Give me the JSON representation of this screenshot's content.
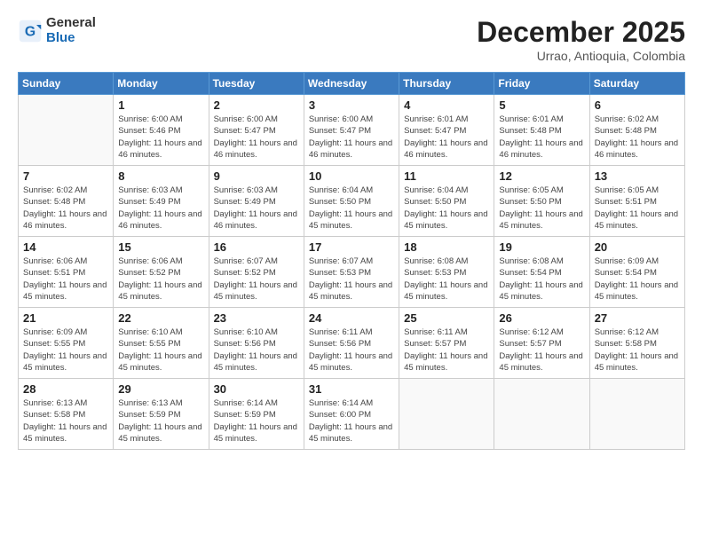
{
  "logo": {
    "general": "General",
    "blue": "Blue"
  },
  "header": {
    "month": "December 2025",
    "location": "Urrao, Antioquia, Colombia"
  },
  "weekdays": [
    "Sunday",
    "Monday",
    "Tuesday",
    "Wednesday",
    "Thursday",
    "Friday",
    "Saturday"
  ],
  "weeks": [
    [
      {
        "day": null
      },
      {
        "day": 1,
        "sunrise": "6:00 AM",
        "sunset": "5:46 PM",
        "daylight": "11 hours and 46 minutes."
      },
      {
        "day": 2,
        "sunrise": "6:00 AM",
        "sunset": "5:47 PM",
        "daylight": "11 hours and 46 minutes."
      },
      {
        "day": 3,
        "sunrise": "6:00 AM",
        "sunset": "5:47 PM",
        "daylight": "11 hours and 46 minutes."
      },
      {
        "day": 4,
        "sunrise": "6:01 AM",
        "sunset": "5:47 PM",
        "daylight": "11 hours and 46 minutes."
      },
      {
        "day": 5,
        "sunrise": "6:01 AM",
        "sunset": "5:48 PM",
        "daylight": "11 hours and 46 minutes."
      },
      {
        "day": 6,
        "sunrise": "6:02 AM",
        "sunset": "5:48 PM",
        "daylight": "11 hours and 46 minutes."
      }
    ],
    [
      {
        "day": 7,
        "sunrise": "6:02 AM",
        "sunset": "5:48 PM",
        "daylight": "11 hours and 46 minutes."
      },
      {
        "day": 8,
        "sunrise": "6:03 AM",
        "sunset": "5:49 PM",
        "daylight": "11 hours and 46 minutes."
      },
      {
        "day": 9,
        "sunrise": "6:03 AM",
        "sunset": "5:49 PM",
        "daylight": "11 hours and 46 minutes."
      },
      {
        "day": 10,
        "sunrise": "6:04 AM",
        "sunset": "5:50 PM",
        "daylight": "11 hours and 45 minutes."
      },
      {
        "day": 11,
        "sunrise": "6:04 AM",
        "sunset": "5:50 PM",
        "daylight": "11 hours and 45 minutes."
      },
      {
        "day": 12,
        "sunrise": "6:05 AM",
        "sunset": "5:50 PM",
        "daylight": "11 hours and 45 minutes."
      },
      {
        "day": 13,
        "sunrise": "6:05 AM",
        "sunset": "5:51 PM",
        "daylight": "11 hours and 45 minutes."
      }
    ],
    [
      {
        "day": 14,
        "sunrise": "6:06 AM",
        "sunset": "5:51 PM",
        "daylight": "11 hours and 45 minutes."
      },
      {
        "day": 15,
        "sunrise": "6:06 AM",
        "sunset": "5:52 PM",
        "daylight": "11 hours and 45 minutes."
      },
      {
        "day": 16,
        "sunrise": "6:07 AM",
        "sunset": "5:52 PM",
        "daylight": "11 hours and 45 minutes."
      },
      {
        "day": 17,
        "sunrise": "6:07 AM",
        "sunset": "5:53 PM",
        "daylight": "11 hours and 45 minutes."
      },
      {
        "day": 18,
        "sunrise": "6:08 AM",
        "sunset": "5:53 PM",
        "daylight": "11 hours and 45 minutes."
      },
      {
        "day": 19,
        "sunrise": "6:08 AM",
        "sunset": "5:54 PM",
        "daylight": "11 hours and 45 minutes."
      },
      {
        "day": 20,
        "sunrise": "6:09 AM",
        "sunset": "5:54 PM",
        "daylight": "11 hours and 45 minutes."
      }
    ],
    [
      {
        "day": 21,
        "sunrise": "6:09 AM",
        "sunset": "5:55 PM",
        "daylight": "11 hours and 45 minutes."
      },
      {
        "day": 22,
        "sunrise": "6:10 AM",
        "sunset": "5:55 PM",
        "daylight": "11 hours and 45 minutes."
      },
      {
        "day": 23,
        "sunrise": "6:10 AM",
        "sunset": "5:56 PM",
        "daylight": "11 hours and 45 minutes."
      },
      {
        "day": 24,
        "sunrise": "6:11 AM",
        "sunset": "5:56 PM",
        "daylight": "11 hours and 45 minutes."
      },
      {
        "day": 25,
        "sunrise": "6:11 AM",
        "sunset": "5:57 PM",
        "daylight": "11 hours and 45 minutes."
      },
      {
        "day": 26,
        "sunrise": "6:12 AM",
        "sunset": "5:57 PM",
        "daylight": "11 hours and 45 minutes."
      },
      {
        "day": 27,
        "sunrise": "6:12 AM",
        "sunset": "5:58 PM",
        "daylight": "11 hours and 45 minutes."
      }
    ],
    [
      {
        "day": 28,
        "sunrise": "6:13 AM",
        "sunset": "5:58 PM",
        "daylight": "11 hours and 45 minutes."
      },
      {
        "day": 29,
        "sunrise": "6:13 AM",
        "sunset": "5:59 PM",
        "daylight": "11 hours and 45 minutes."
      },
      {
        "day": 30,
        "sunrise": "6:14 AM",
        "sunset": "5:59 PM",
        "daylight": "11 hours and 45 minutes."
      },
      {
        "day": 31,
        "sunrise": "6:14 AM",
        "sunset": "6:00 PM",
        "daylight": "11 hours and 45 minutes."
      },
      {
        "day": null
      },
      {
        "day": null
      },
      {
        "day": null
      }
    ]
  ]
}
